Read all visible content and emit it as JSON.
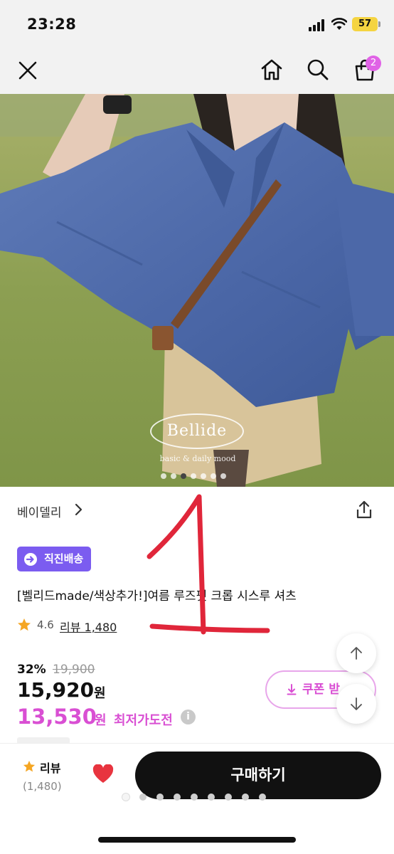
{
  "status_bar": {
    "time": "23:28",
    "battery": "57",
    "icons": [
      "signal-icon",
      "wifi-icon",
      "battery-icon"
    ]
  },
  "nav": {
    "icons": [
      "close-icon",
      "home-icon",
      "search-icon",
      "shopping-bag-icon"
    ],
    "cart_badge": "2"
  },
  "hero": {
    "brand_name": "Bellide",
    "brand_tagline": "basic & daily mood",
    "slide_count": 7,
    "active_slide": 2
  },
  "seller": {
    "name": "베이델리",
    "icons": [
      "chevron-right-icon",
      "share-icon"
    ]
  },
  "product": {
    "badge": "직진배송",
    "title": "[벨리드made/색상추가!]여름 루즈핏 크롭 시스루 셔츠",
    "rating": "4.6",
    "review_link": "리뷰 1,480",
    "discount": "32%",
    "original_price": "19,900",
    "price": "15,920",
    "price_unit": "원",
    "best_price": "13,530",
    "best_price_unit": "원",
    "best_price_label": "최저가도전",
    "info_icon": "i"
  },
  "coupon": {
    "label": "쿠폰 받"
  },
  "bottom_bar": {
    "review_label": "리뷰",
    "review_count": "(1,480)",
    "buy_label": "구매하기",
    "page_dot_count": 9,
    "active_page_dot": 0
  },
  "annotation": {
    "text": "1",
    "color": "#e0263a"
  },
  "colors": {
    "accent_pink": "#d94fd3",
    "badge_purple": "#7b5cf0",
    "star": "#f5a623",
    "heart": "#e8343f"
  }
}
